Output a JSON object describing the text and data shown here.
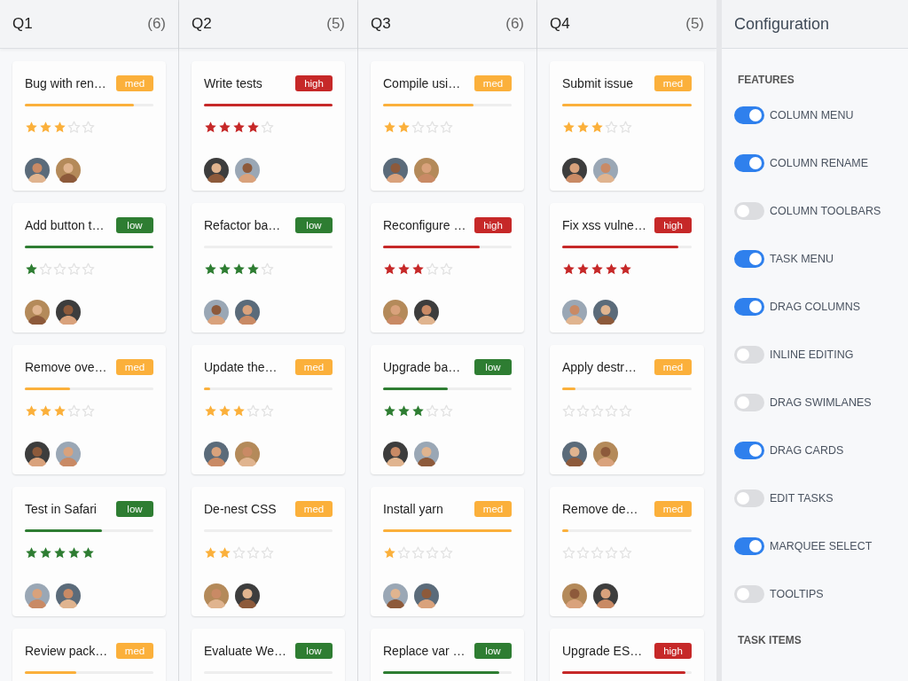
{
  "columns": [
    {
      "title": "Q1",
      "count": "(6)",
      "cards": [
        {
          "title": "Bug with ren…",
          "badge": "med",
          "color": "#fbb03b",
          "level": 0.85,
          "stars": 3,
          "assignees": [
            {
              "kind": "picture"
            },
            {
              "kind": "picture"
            }
          ]
        },
        {
          "title": "Add button t…",
          "badge": "low",
          "color": "#2e7d32",
          "level": 1,
          "stars": 1,
          "assignees": [
            {
              "kind": "picture"
            },
            {
              "kind": "picture"
            }
          ]
        },
        {
          "title": "Remove ove…",
          "badge": "med",
          "color": "#fbb03b",
          "level": 0.35,
          "stars": 3,
          "assignees": [
            {
              "kind": "picture"
            },
            {
              "kind": "picture"
            }
          ]
        },
        {
          "title": "Test in Safari",
          "badge": "low",
          "color": "#2e7d32",
          "level": 0.6,
          "stars": 5,
          "assignees": [
            {
              "kind": "picture"
            },
            {
              "kind": "picture"
            }
          ]
        },
        {
          "title": "Review pack…",
          "badge": "med",
          "color": "#fbb03b",
          "level": 0.4
        }
      ]
    },
    {
      "title": "Q2",
      "count": "(5)",
      "cards": [
        {
          "title": "Write tests",
          "badge": "high",
          "color": "#c62828",
          "level": 1,
          "stars": 4,
          "assignees": [
            {
              "kind": "picture"
            },
            {
              "kind": "picture"
            }
          ]
        },
        {
          "title": "Refactor ba…",
          "badge": "low",
          "color": "#2e7d32",
          "level": 0,
          "stars": 4,
          "assignees": [
            {
              "kind": "picture"
            },
            {
              "kind": "picture"
            }
          ]
        },
        {
          "title": "Update the…",
          "badge": "med",
          "color": "#fbb03b",
          "level": 0.05,
          "stars": 3,
          "assignees": [
            {
              "kind": "picture"
            },
            {
              "kind": "picture"
            }
          ]
        },
        {
          "title": "De-nest CSS",
          "badge": "med",
          "color": "#fbb03b",
          "level": 0,
          "stars": 2,
          "assignees": [
            {
              "kind": "picture"
            },
            {
              "kind": "picture"
            }
          ]
        },
        {
          "title": "Evaluate We…",
          "badge": "low",
          "color": "#2e7d32",
          "level": 0
        }
      ]
    },
    {
      "title": "Q3",
      "count": "(6)",
      "cards": [
        {
          "title": "Compile usi…",
          "badge": "med",
          "color": "#fbb03b",
          "level": 0.7,
          "stars": 2,
          "assignees": [
            {
              "kind": "picture"
            },
            {
              "kind": "picture"
            }
          ]
        },
        {
          "title": "Reconfigure …",
          "badge": "high",
          "color": "#c62828",
          "level": 0.75,
          "stars": 3,
          "assignees": [
            {
              "kind": "picture"
            },
            {
              "kind": "picture"
            }
          ]
        },
        {
          "title": "Upgrade ba…",
          "badge": "low",
          "color": "#2e7d32",
          "level": 0.5,
          "stars": 3,
          "assignees": [
            {
              "kind": "picture"
            },
            {
              "kind": "picture"
            }
          ]
        },
        {
          "title": "Install yarn",
          "badge": "med",
          "color": "#fbb03b",
          "level": 1,
          "stars": 1,
          "assignees": [
            {
              "kind": "picture"
            },
            {
              "kind": "picture"
            }
          ]
        },
        {
          "title": "Replace var …",
          "badge": "low",
          "color": "#2e7d32",
          "level": 0.9
        }
      ]
    },
    {
      "title": "Q4",
      "count": "(5)",
      "cards": [
        {
          "title": "Submit issue",
          "badge": "med",
          "color": "#fbb03b",
          "level": 1,
          "stars": 3,
          "assignees": [
            {
              "kind": "picture"
            },
            {
              "kind": "picture"
            }
          ]
        },
        {
          "title": "Fix xss vulne…",
          "badge": "high",
          "color": "#c62828",
          "level": 0.9,
          "stars": 5,
          "assignees": [
            {
              "kind": "picture"
            },
            {
              "kind": "picture"
            }
          ]
        },
        {
          "title": "Apply destr…",
          "badge": "med",
          "color": "#fbb03b",
          "level": 0.1,
          "stars": 0,
          "assignees": [
            {
              "kind": "picture"
            },
            {
              "kind": "picture"
            }
          ]
        },
        {
          "title": "Remove de…",
          "badge": "med",
          "color": "#fbb03b",
          "level": 0.05,
          "stars": 0,
          "assignees": [
            {
              "kind": "picture"
            },
            {
              "kind": "picture"
            }
          ]
        },
        {
          "title": "Upgrade ES…",
          "badge": "high",
          "color": "#c62828",
          "level": 0.95
        }
      ]
    }
  ],
  "config": {
    "title": "Configuration",
    "sections": [
      {
        "heading": "FEATURES",
        "toggles": [
          {
            "label": "COLUMN MENU",
            "on": true
          },
          {
            "label": "COLUMN RENAME",
            "on": true
          },
          {
            "label": "COLUMN TOOLBARS",
            "on": false
          },
          {
            "label": "TASK MENU",
            "on": true
          },
          {
            "label": "DRAG COLUMNS",
            "on": true
          },
          {
            "label": "INLINE EDITING",
            "on": false
          },
          {
            "label": "DRAG SWIMLANES",
            "on": false
          },
          {
            "label": "DRAG CARDS",
            "on": true
          },
          {
            "label": "EDIT TASKS",
            "on": false
          },
          {
            "label": "MARQUEE SELECT",
            "on": true
          },
          {
            "label": "TOOLTIPS",
            "on": false
          }
        ]
      },
      {
        "heading": "TASK ITEMS"
      }
    ]
  }
}
